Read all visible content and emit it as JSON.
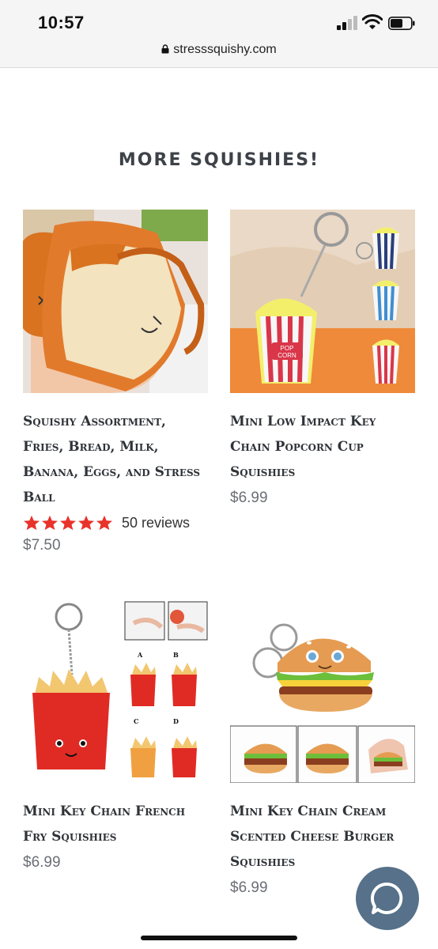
{
  "status_bar": {
    "time": "10:57"
  },
  "browser": {
    "url": "stresssquishy.com"
  },
  "section": {
    "title": "MORE SQUISHIES!"
  },
  "products": [
    {
      "title": "Squishy Assortment, Fries, Bread, Milk, Banana, Eggs, and Stress Ball",
      "rating_stars": 5,
      "reviews": "50 reviews",
      "price": "$7.50",
      "image_icon": "bread-squishy-image"
    },
    {
      "title": "Mini Low Impact Key Chain Popcorn Cup Squishies",
      "price": "$6.99",
      "image_icon": "popcorn-keychain-image"
    },
    {
      "title": "Mini Key Chain French Fry Squishies",
      "price": "$6.99",
      "image_icon": "french-fry-keychain-image"
    },
    {
      "title": "Mini Key Chain Cream Scented Cheese Burger Squishies",
      "price": "$6.99",
      "image_icon": "burger-keychain-image"
    }
  ],
  "colors": {
    "star": "#e8332a",
    "chat_button": "#567189",
    "title_text": "#3d4248",
    "price_text": "#6b6f75"
  }
}
